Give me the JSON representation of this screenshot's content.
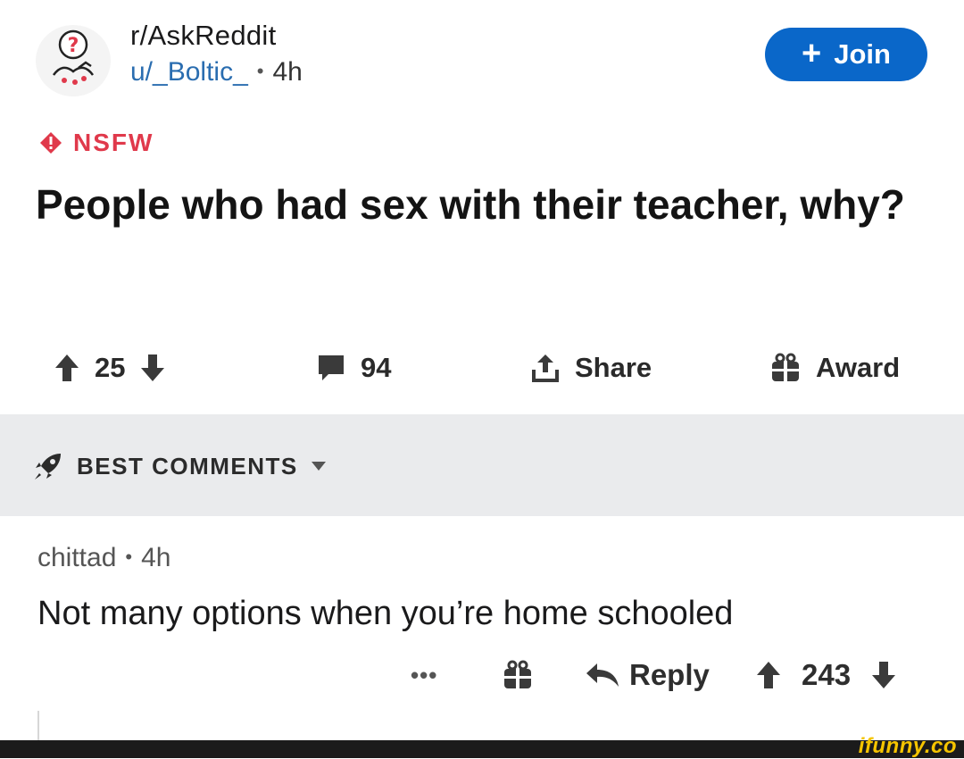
{
  "post": {
    "subreddit": "r/AskReddit",
    "author": "u/_Boltic_",
    "separator": "•",
    "age": "4h",
    "join_label": "Join",
    "nsfw_label": "NSFW",
    "title": "People who had sex with their teacher, why?",
    "score": "25",
    "comments_count": "94",
    "share_label": "Share",
    "award_label": "Award"
  },
  "sort": {
    "label": "BEST COMMENTS"
  },
  "comment": {
    "author": "chittad",
    "separator": "•",
    "age": "4h",
    "body": "Not many options when you’re home schooled",
    "more_label": "•••",
    "reply_label": "Reply",
    "score": "243"
  },
  "watermark": "ifunny.co",
  "colors": {
    "join_bg": "#0a67c9",
    "nsfw": "#e0394b",
    "band_bg": "#eaebed",
    "watermark": "#f5c400"
  }
}
